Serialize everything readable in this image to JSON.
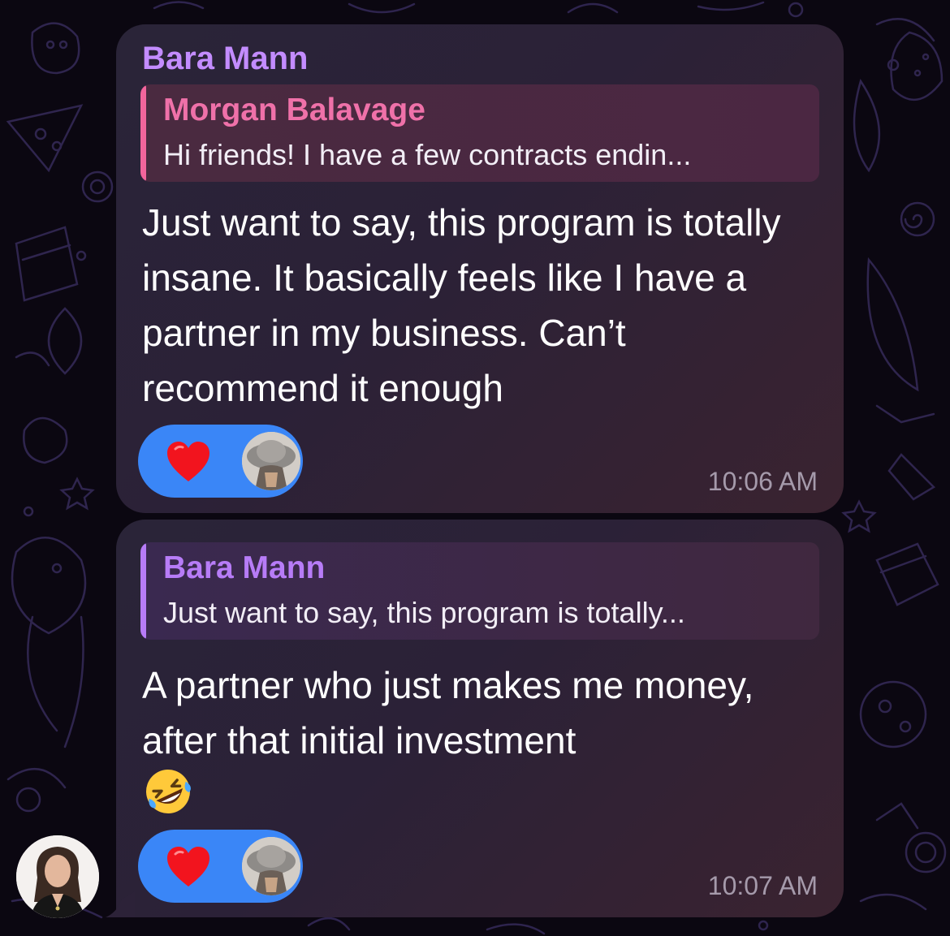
{
  "messages": [
    {
      "sender": "Bara Mann",
      "reply": {
        "name": "Morgan Balavage",
        "text": "Hi friends! I have a few contracts endin..."
      },
      "text": "Just want to say, this program is totally insane. It basically feels like I have a partner in my business. Can’t recommend it enough",
      "reaction": {
        "emoji": "heart",
        "color": "#3a86f7"
      },
      "time": "10:06 AM"
    },
    {
      "reply": {
        "name": "Bara Mann",
        "text": "Just want to say, this program is totally..."
      },
      "text": "A partner who just makes me money, after that initial investment",
      "trailing_emoji": "rolling-on-floor-laughing",
      "reaction": {
        "emoji": "heart",
        "color": "#3a86f7"
      },
      "time": "10:07 AM"
    }
  ],
  "colors": {
    "sender_name": "#c38cff",
    "reply_bar_1": "#f2659c",
    "reply_bar_2": "#b77cf7",
    "reaction_pill": "#3a86f7",
    "timestamp": "#a59aab"
  }
}
